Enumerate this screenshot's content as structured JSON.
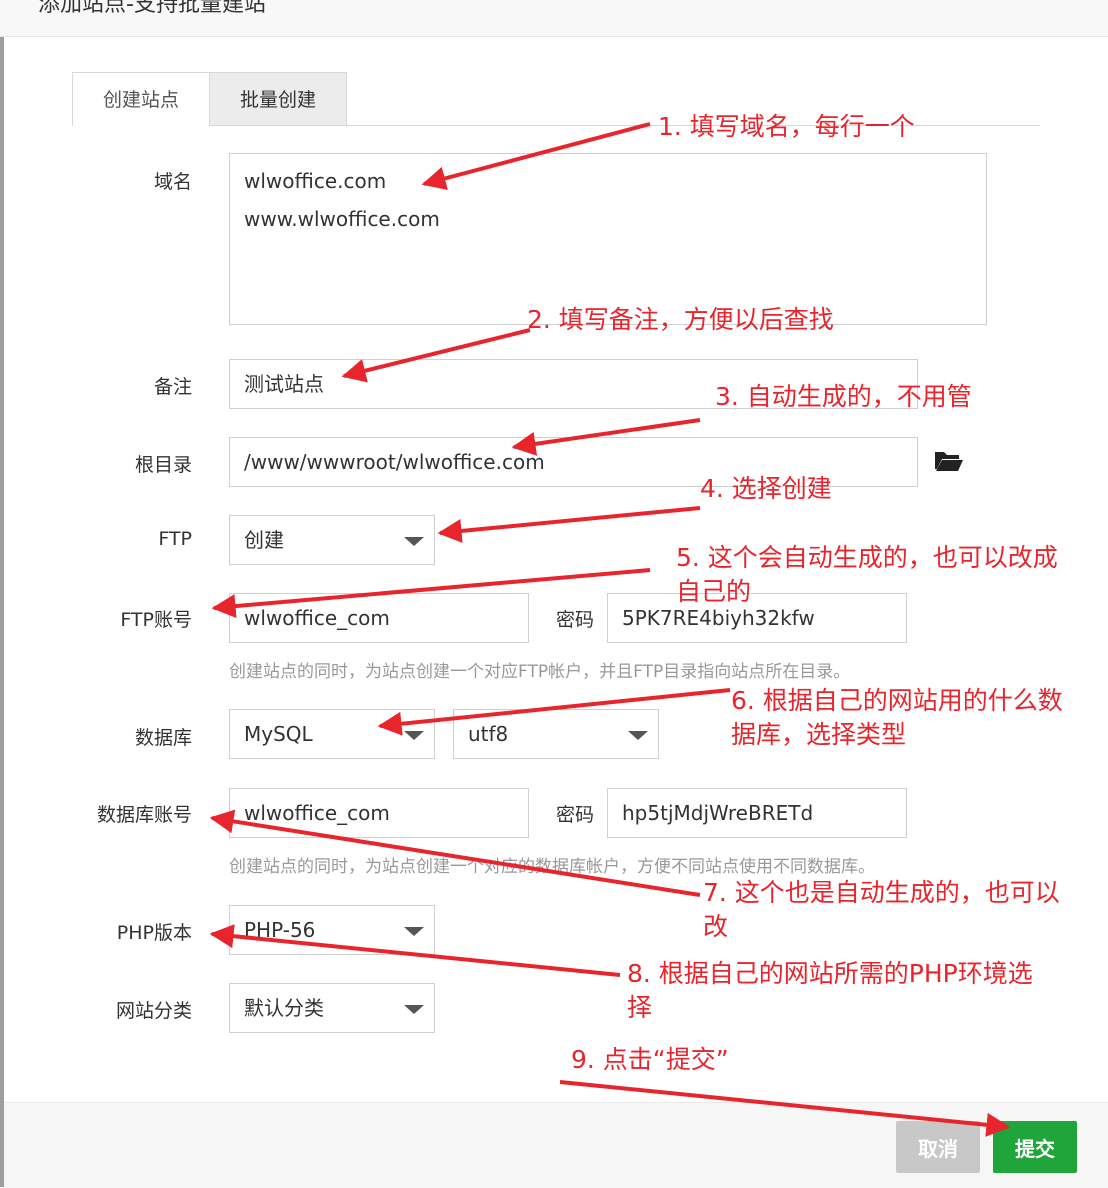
{
  "dialog": {
    "title": "添加站点-支持批量建站"
  },
  "tabs": [
    {
      "label": "创建站点",
      "active": true
    },
    {
      "label": "批量创建",
      "active": false
    }
  ],
  "form": {
    "domain": {
      "label": "域名",
      "lines": [
        "wlwoffice.com",
        "www.wlwoffice.com"
      ]
    },
    "remark": {
      "label": "备注",
      "value": "测试站点"
    },
    "root": {
      "label": "根目录",
      "value": "/www/wwwroot/wlwoffice.com",
      "icon": "folder-open-icon"
    },
    "ftp": {
      "label": "FTP",
      "value": "创建"
    },
    "ftp_account": {
      "label": "FTP账号",
      "user": "wlwoffice_com",
      "password_label": "密码",
      "password": "5PK7RE4biyh32kfw",
      "hint": "创建站点的同时，为站点创建一个对应FTP帐户，并且FTP目录指向站点所在目录。"
    },
    "database": {
      "label": "数据库",
      "type": "MySQL",
      "charset": "utf8"
    },
    "db_account": {
      "label": "数据库账号",
      "user": "wlwoffice_com",
      "password_label": "密码",
      "password": "hp5tjMdjWreBRETd",
      "hint": "创建站点的同时，为站点创建一个对应的数据库帐户，方便不同站点使用不同数据库。"
    },
    "php": {
      "label": "PHP版本",
      "value": "PHP-56"
    },
    "category": {
      "label": "网站分类",
      "value": "默认分类"
    }
  },
  "buttons": {
    "cancel": "取消",
    "submit": "提交"
  },
  "annotations": {
    "n1": "1. 填写域名，每行一个",
    "n2": "2. 填写备注，方便以后查找",
    "n3": "3. 自动生成的，不用管",
    "n4": "4. 选择创建",
    "n5a": "5. 这个会自动生成的，也可以改成",
    "n5b": "自己的",
    "n6a": "6. 根据自己的网站用的什么数",
    "n6b": "据库，选择类型",
    "n7a": "7. 这个也是自动生成的，也可以",
    "n7b": "改",
    "n8a": "8. 根据自己的网站所需的PHP环境选",
    "n8b": "择",
    "n9": "9. 点击“提交”"
  },
  "colors": {
    "annotation": "#e8242c",
    "submit": "#20a53a",
    "cancel": "#c8c8c8"
  }
}
